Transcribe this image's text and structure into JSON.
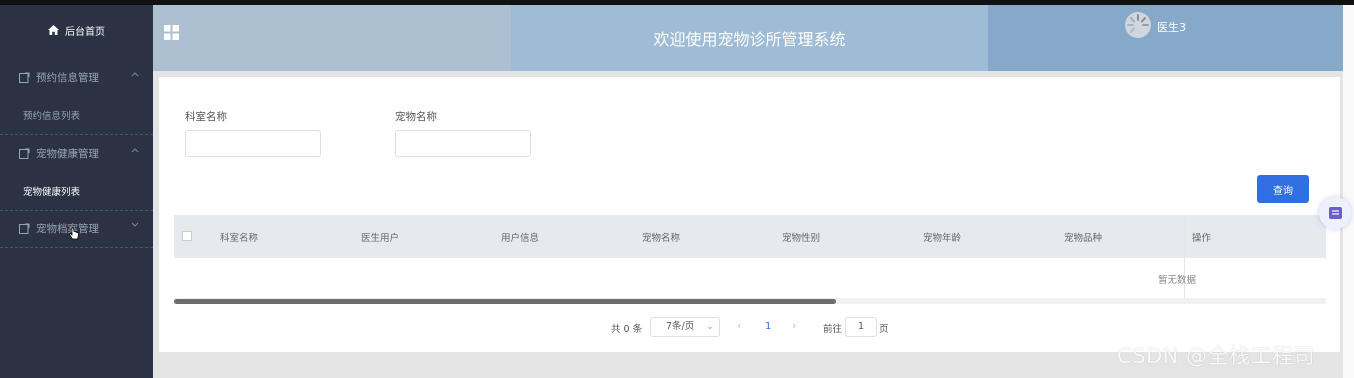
{
  "sidebar": {
    "home_label": "后台首页",
    "groups": [
      {
        "label": "预约信息管理",
        "sub": "预约信息列表"
      },
      {
        "label": "宠物健康管理",
        "sub": "宠物健康列表"
      },
      {
        "label": "宠物档案管理"
      }
    ]
  },
  "header": {
    "title": "欢迎使用宠物诊所管理系统",
    "user": "医生3"
  },
  "search": {
    "field1_label": "科室名称",
    "field1_value": "",
    "field2_label": "宠物名称",
    "field2_value": "",
    "button_label": "查询"
  },
  "table": {
    "columns": [
      "科室名称",
      "医生用户",
      "用户信息",
      "宠物名称",
      "宠物性别",
      "宠物年龄",
      "宠物品种",
      "操作"
    ],
    "empty_text": "暂无数据"
  },
  "pagination": {
    "total_text": "共 0 条",
    "page_size": "7条/页",
    "current_page": "1",
    "goto_label": "前往",
    "goto_value": "1",
    "page_suffix": "页"
  },
  "watermark": "CSDN @全栈工程司",
  "colors": {
    "sidebar_bg": "#2b3244",
    "primary": "#2f6fe0"
  }
}
